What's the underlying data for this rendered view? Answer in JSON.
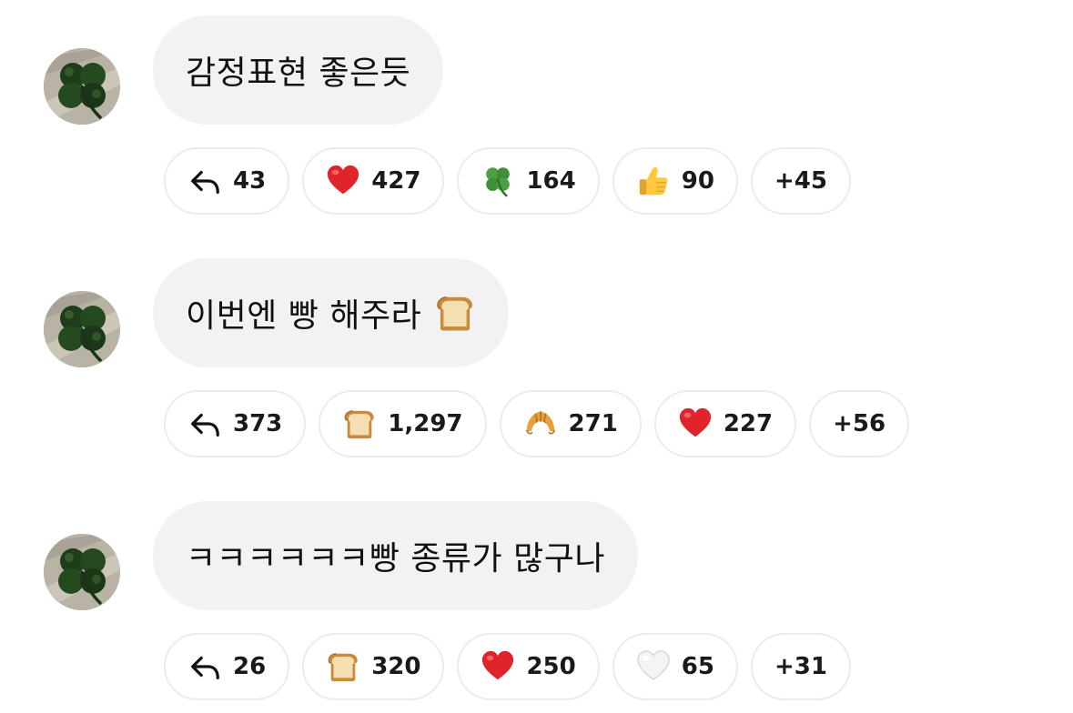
{
  "comments": [
    {
      "text": "감정표현 좋은듯",
      "reactions": [
        {
          "icon": "reply-arrow-icon",
          "count": "43"
        },
        {
          "icon": "red-heart-icon",
          "count": "427"
        },
        {
          "icon": "four-leaf-clover-icon",
          "count": "164"
        },
        {
          "icon": "thumbs-up-icon",
          "count": "90"
        }
      ],
      "more": "+45"
    },
    {
      "text": "이번엔 빵 해주라",
      "trailing_emoji": "bread-icon",
      "reactions": [
        {
          "icon": "reply-arrow-icon",
          "count": "373"
        },
        {
          "icon": "bread-icon",
          "count": "1,297"
        },
        {
          "icon": "croissant-icon",
          "count": "271"
        },
        {
          "icon": "red-heart-icon",
          "count": "227"
        }
      ],
      "more": "+56"
    },
    {
      "text": "ㅋㅋㅋㅋㅋㅋ빵 종류가 많구나",
      "reactions": [
        {
          "icon": "reply-arrow-icon",
          "count": "26"
        },
        {
          "icon": "bread-icon",
          "count": "320"
        },
        {
          "icon": "red-heart-icon",
          "count": "250"
        },
        {
          "icon": "white-heart-icon",
          "count": "65"
        }
      ],
      "more": "+31"
    }
  ],
  "colors": {
    "bubble_bg": "#f2f2f4",
    "chip_border": "#ececee",
    "heart_red": "#e0242c",
    "clover_green": "#3f8f3a"
  }
}
